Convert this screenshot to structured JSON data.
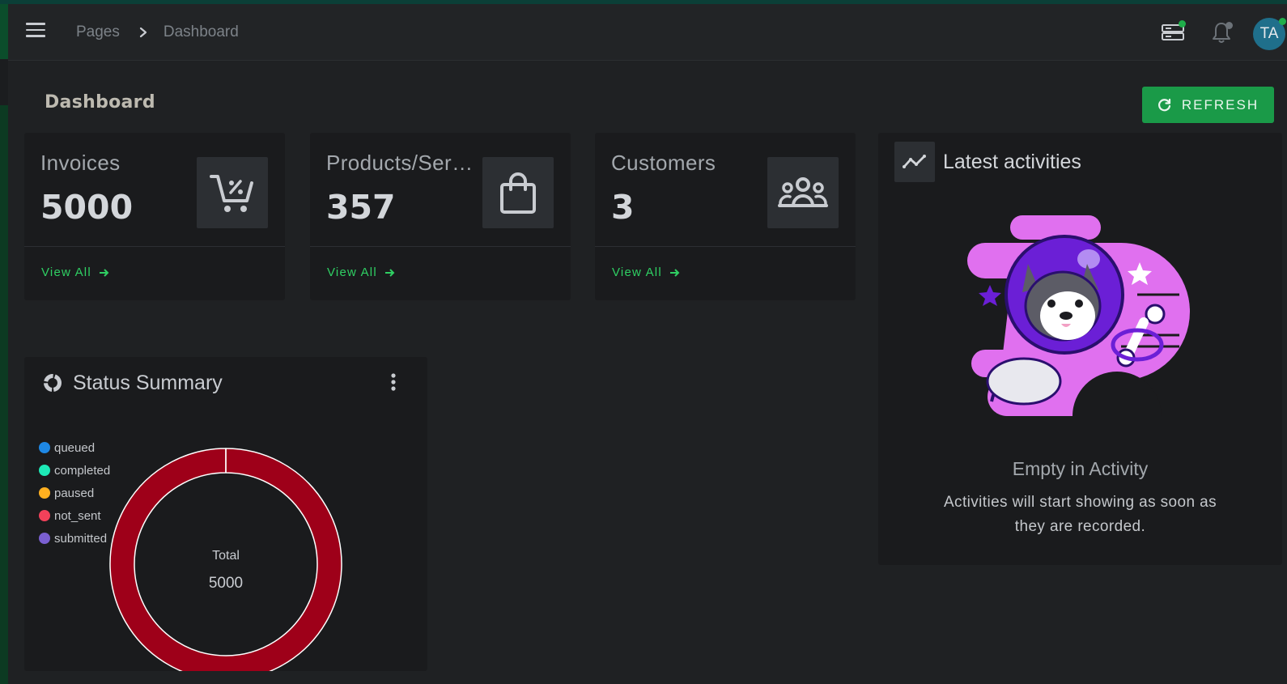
{
  "breadcrumb": {
    "root": "Pages",
    "current": "Dashboard"
  },
  "header": {
    "avatar_initials": "TA"
  },
  "page": {
    "title": "Dashboard",
    "refresh_label": "REFRESH"
  },
  "stats": [
    {
      "label": "Invoices",
      "value": "5000",
      "link": "View All",
      "icon": "shopping-cart-icon"
    },
    {
      "label": "Products/Services",
      "value": "357",
      "link": "View All",
      "icon": "shopping-bag-icon"
    },
    {
      "label": "Customers",
      "value": "3",
      "link": "View All",
      "icon": "users-icon"
    }
  ],
  "status_summary": {
    "title": "Status Summary",
    "legend": [
      {
        "label": "queued",
        "color": "#1e88e5"
      },
      {
        "label": "completed",
        "color": "#1de9b6"
      },
      {
        "label": "paused",
        "color": "#ffb020"
      },
      {
        "label": "not_sent",
        "color": "#f2415a"
      },
      {
        "label": "submitted",
        "color": "#7a5fd1"
      }
    ],
    "center_label": "Total",
    "center_value": "5000",
    "ring_color": "#9e0019"
  },
  "chart_data": {
    "type": "pie",
    "categories": [
      "queued",
      "completed",
      "paused",
      "not_sent",
      "submitted"
    ],
    "values": [
      0,
      0,
      0,
      5000,
      0
    ],
    "title": "Status Summary"
  },
  "activities": {
    "title": "Latest activities",
    "empty_title": "Empty in Activity",
    "empty_text": "Activities will start showing as soon as they are recorded."
  },
  "colors": {
    "accent": "#1a9a48",
    "link": "#2fcf63"
  }
}
